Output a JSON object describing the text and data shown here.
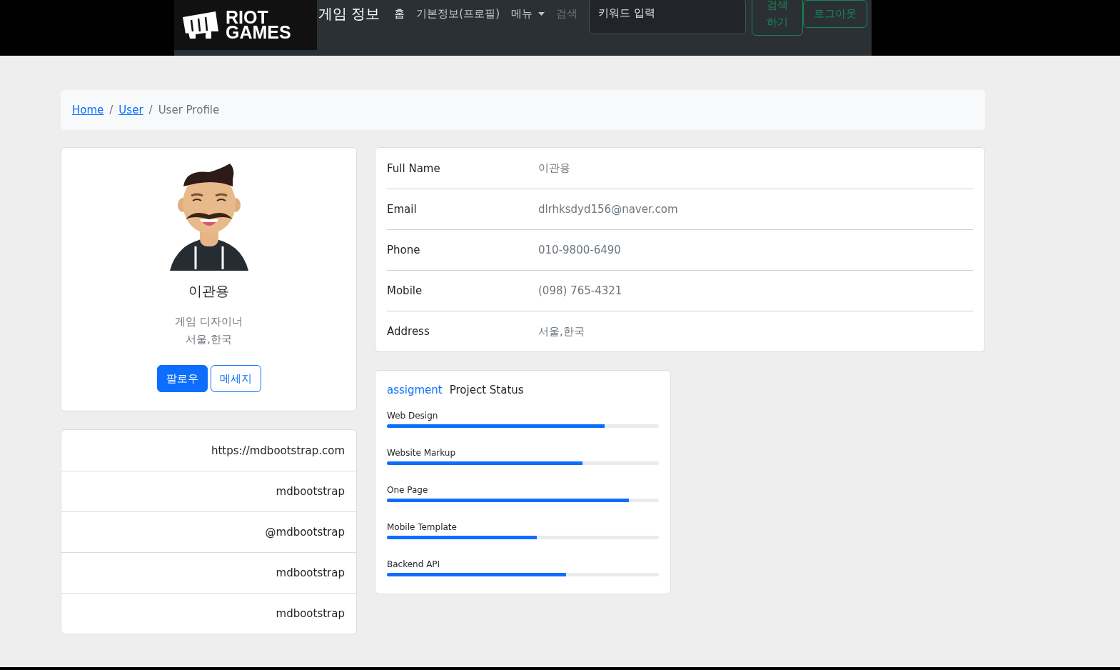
{
  "navbar": {
    "logo_lines": [
      "RIOT",
      "GAMES"
    ],
    "brand": "게임 정보",
    "links": [
      {
        "label": "홈",
        "kind": "link",
        "disabled": false
      },
      {
        "label": "기본정보(프로필)",
        "kind": "link",
        "disabled": false
      },
      {
        "label": "메뉴",
        "kind": "dropdown",
        "disabled": false
      },
      {
        "label": "검색",
        "kind": "link",
        "disabled": true
      }
    ],
    "search": {
      "placeholder": "키워드 입력"
    },
    "search_button": "검색 하기",
    "logout_button": "로그아웃"
  },
  "breadcrumb_separator": "/",
  "breadcrumb": [
    {
      "label": "Home",
      "kind": "link"
    },
    {
      "label": "User",
      "kind": "link"
    },
    {
      "label": "User Profile",
      "kind": "current"
    }
  ],
  "profile": {
    "name": "이관용",
    "role": "게임 디자이너",
    "location": "서울,한국",
    "buttons": [
      {
        "label": "팔로우",
        "kind": "primary"
      },
      {
        "label": "메세지",
        "kind": "outline"
      }
    ]
  },
  "links_list": [
    "https://mdbootstrap.com",
    "mdbootstrap",
    "@mdbootstrap",
    "mdbootstrap",
    "mdbootstrap"
  ],
  "details": [
    {
      "label": "Full Name",
      "value": "이관용"
    },
    {
      "label": "Email",
      "value": "dlrhksdyd156@naver.com"
    },
    {
      "label": "Phone",
      "value": "010-9800-6490"
    },
    {
      "label": "Mobile",
      "value": "(098) 765-4321"
    },
    {
      "label": "Address",
      "value": "서울,한국"
    }
  ],
  "project_status": {
    "tag": "assigment",
    "title": "Project Status",
    "items": [
      {
        "name": "Web Design",
        "level": 0.8
      },
      {
        "name": "Website Markup",
        "level": 0.72
      },
      {
        "name": "One Page",
        "level": 0.89
      },
      {
        "name": "Mobile Template",
        "level": 0.55
      },
      {
        "name": "Backend API",
        "level": 0.66
      }
    ]
  }
}
